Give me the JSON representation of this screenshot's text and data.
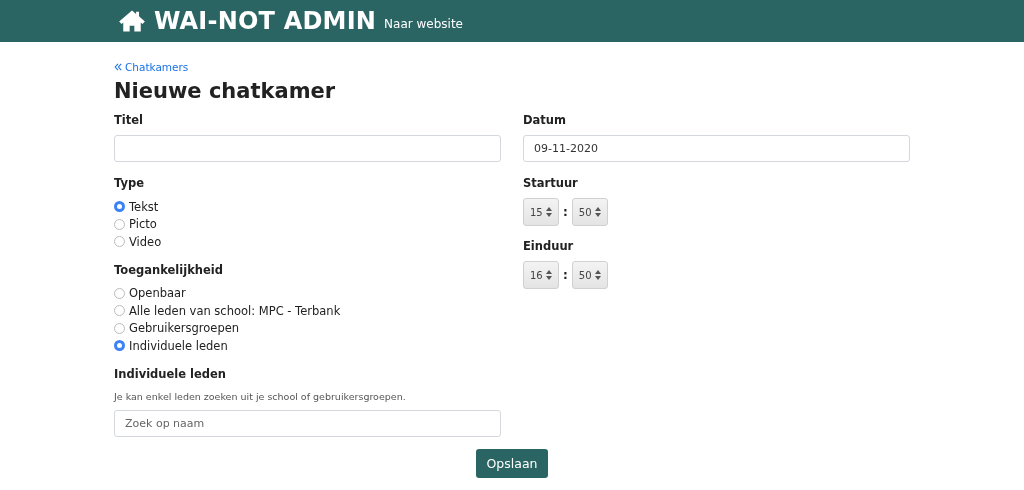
{
  "header": {
    "title": "WAI-NOT ADMIN",
    "link": "Naar website"
  },
  "back_link": "Chatkamers",
  "page_title": "Nieuwe chatkamer",
  "titel": {
    "label": "Titel"
  },
  "type": {
    "label": "Type",
    "options": [
      {
        "label": "Tekst",
        "selected": true
      },
      {
        "label": "Picto",
        "selected": false
      },
      {
        "label": "Video",
        "selected": false
      }
    ]
  },
  "toegankelijkheid": {
    "label": "Toegankelijkheid",
    "options": [
      {
        "label": "Openbaar",
        "selected": false
      },
      {
        "label": "Alle leden van school: MPC - Terbank",
        "selected": false
      },
      {
        "label": "Gebruikersgroepen",
        "selected": false
      },
      {
        "label": "Individuele leden",
        "selected": true
      }
    ]
  },
  "individuele_leden": {
    "label": "Individuele leden",
    "help": "Je kan enkel leden zoeken uit je school of gebruikersgroepen.",
    "placeholder": "Zoek op naam"
  },
  "datum": {
    "label": "Datum",
    "value": "09-11-2020"
  },
  "times": [
    {
      "label": "Startuur",
      "hour": "15",
      "separator": ":",
      "minute": "50"
    },
    {
      "label": "Einduur",
      "hour": "16",
      "separator": ":",
      "minute": "50"
    }
  ],
  "save_button": "Opslaan"
}
